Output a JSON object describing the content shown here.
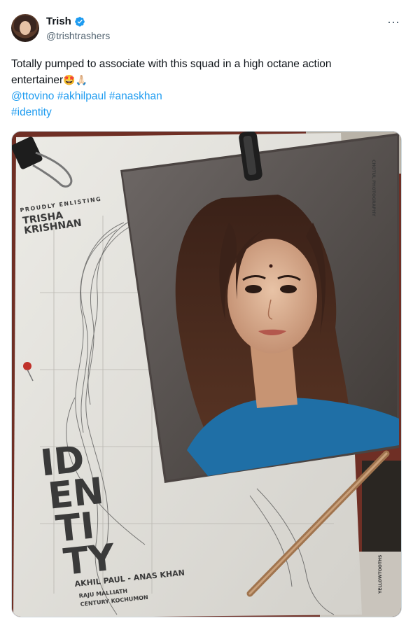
{
  "user": {
    "display_name": "Trish",
    "handle": "@trishtrashers",
    "verified_color": "#1d9bf0"
  },
  "tweet": {
    "text_line1": "Totally pumped to associate with this squad in a high octane action",
    "text_line2": "entertainer",
    "emoji": "🤩🙏🏻",
    "mentions": [
      {
        "text": "@ttovino"
      },
      {
        "text": "#akhilpaul"
      },
      {
        "text": "#anaskhan"
      }
    ],
    "hashtag_line": "#identity"
  },
  "poster": {
    "kicker": "PROUDLY ENLISTING",
    "actor_line1": "TRISHA",
    "actor_line2": "KRISHNAN",
    "title_lines": [
      "ID",
      "EN",
      "TI",
      "TY"
    ],
    "director": "AKHIL PAUL - ANAS KHAN",
    "producer_line1": "RAJU MALLIATH",
    "producer_line2": "CENTURY KOCHUMON",
    "side_credit": "YELLOWTOOTHS",
    "photo_credit": "CHOTUL PHOTOGRAPHY"
  },
  "icons": {
    "more": "⋯"
  },
  "colors": {
    "link": "#1d9bf0",
    "text": "#0f1419",
    "muted": "#536471"
  }
}
